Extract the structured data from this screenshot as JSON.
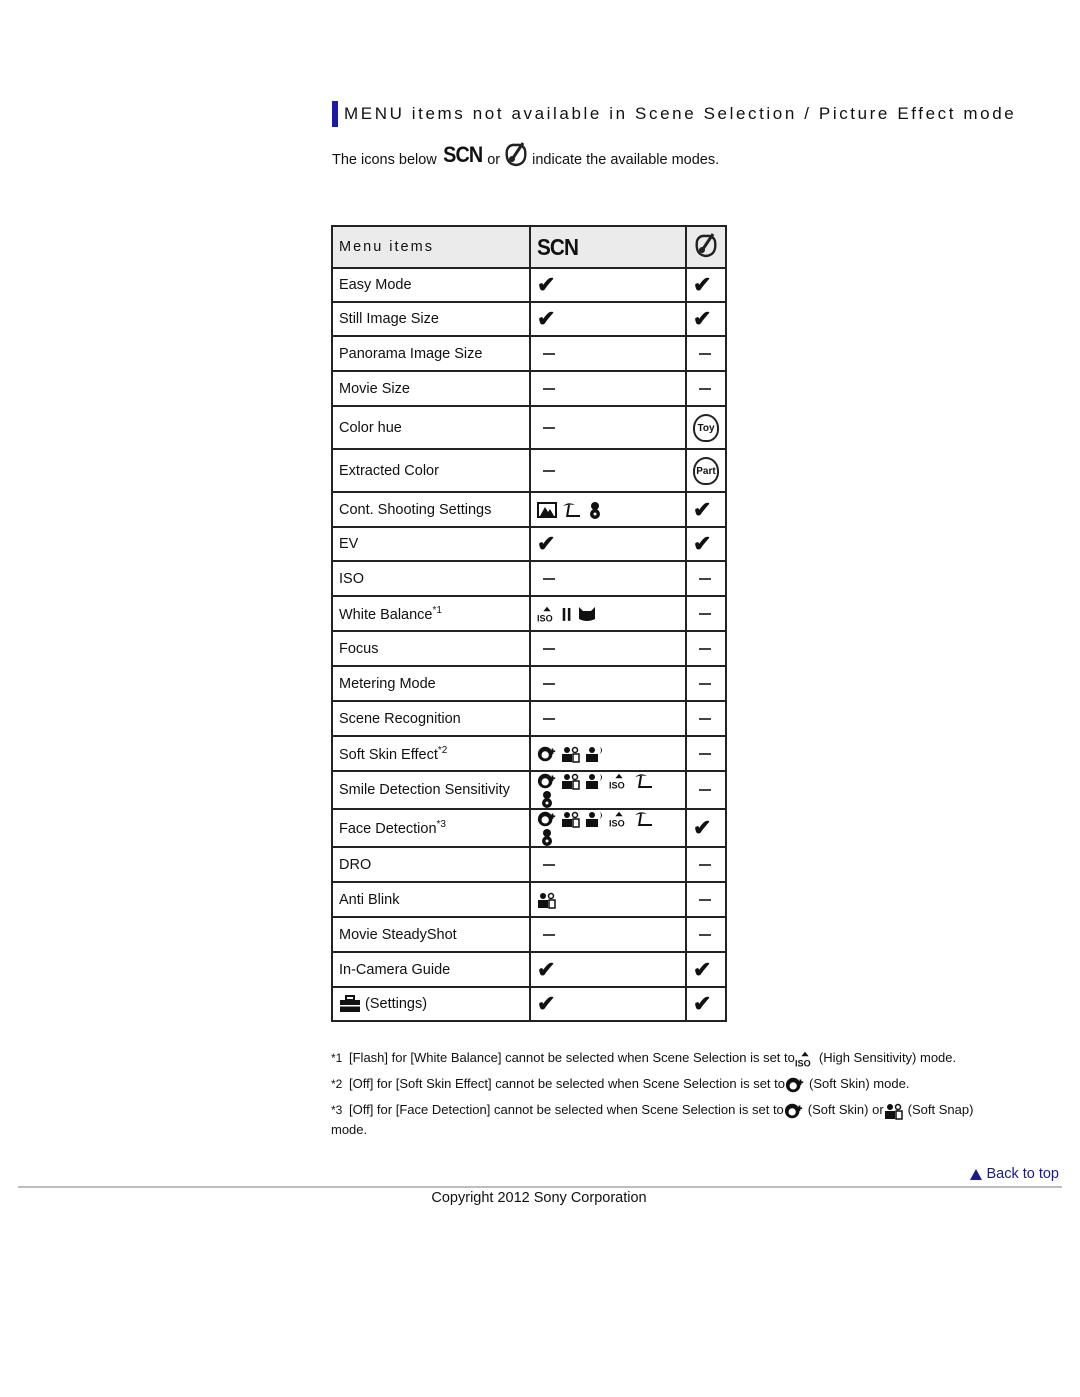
{
  "section": {
    "title": "MENU items not available in Scene Selection / Picture Effect mode",
    "intro_prefix": "The icons below",
    "intro_scn": "SCN",
    "intro_or": "or",
    "intro_suffix": "indicate the available modes.",
    "accent_color": "#1a1aa6"
  },
  "table": {
    "header": {
      "label": "Menu items",
      "col_scn": "SCN",
      "col_pe_icon": "picture-effect-icon"
    },
    "rows": [
      {
        "label": "Easy Mode",
        "scn": "check",
        "pe": "check"
      },
      {
        "label": "Still Image Size",
        "scn": "check",
        "pe": "check"
      },
      {
        "label": "Panorama Image Size",
        "scn": "dash",
        "pe": "dash"
      },
      {
        "label": "Movie Size",
        "scn": "dash",
        "pe": "dash"
      },
      {
        "label": "Color hue",
        "scn": "dash",
        "pe": "Toy"
      },
      {
        "label": "Extracted Color",
        "scn": "dash",
        "pe": "Part"
      },
      {
        "label": "Cont. Shooting Settings",
        "scn": [
          "landscape-icon",
          "beach-icon",
          "snow-icon"
        ],
        "pe": "check"
      },
      {
        "label": "EV",
        "scn": "check",
        "pe": "check"
      },
      {
        "label": "ISO",
        "scn": "dash",
        "pe": "dash"
      },
      {
        "label": "White Balance",
        "sup": "*1",
        "scn": [
          "high-sensitivity-icon",
          "gourmet-icon",
          "pet-icon"
        ],
        "pe": "dash"
      },
      {
        "label": "Focus",
        "scn": "dash",
        "pe": "dash"
      },
      {
        "label": "Metering Mode",
        "scn": "dash",
        "pe": "dash"
      },
      {
        "label": "Scene Recognition",
        "scn": "dash",
        "pe": "dash"
      },
      {
        "label": "Soft Skin Effect",
        "sup": "*2",
        "scn": [
          "soft-skin-icon",
          "soft-snap-icon",
          "night-portrait-icon"
        ],
        "pe": "dash"
      },
      {
        "label": "Smile Detection Sensitivity",
        "scn": [
          "soft-skin-icon",
          "soft-snap-icon",
          "night-portrait-icon",
          "high-sensitivity-icon",
          "beach-icon",
          "snow-icon"
        ],
        "pe": "dash"
      },
      {
        "label": "Face Detection",
        "sup": "*3",
        "scn": [
          "soft-skin-icon",
          "soft-snap-icon",
          "night-portrait-icon",
          "high-sensitivity-icon",
          "beach-icon",
          "snow-icon"
        ],
        "pe": "check"
      },
      {
        "label": "DRO",
        "scn": "dash",
        "pe": "dash"
      },
      {
        "label": "Anti Blink",
        "scn": [
          "soft-snap-icon"
        ],
        "pe": "dash"
      },
      {
        "label": "Movie SteadyShot",
        "scn": "dash",
        "pe": "dash"
      },
      {
        "label": "In-Camera Guide",
        "scn": "check",
        "pe": "check"
      },
      {
        "label": "(Settings)",
        "icon": "toolbox-icon",
        "scn": "check",
        "pe": "check"
      }
    ]
  },
  "footnotes": [
    {
      "mark": "*1",
      "text_before": "[Flash] for [White Balance] cannot be selected when Scene Selection is set to",
      "icon": "high-sensitivity-icon",
      "text_after": "(High Sensitivity) mode."
    },
    {
      "mark": "*2",
      "text_before": "[Off] for [Soft Skin Effect] cannot be selected when Scene Selection is set to",
      "icon": "soft-skin-icon",
      "text_after": "(Soft Skin) mode."
    },
    {
      "mark": "*3",
      "text_before": "[Off] for [Face Detection] cannot be selected when Scene Selection is set to",
      "icon": "soft-skin-icon",
      "text_middle": "(Soft Skin) or",
      "icon2": "soft-snap-icon",
      "text_after": "(Soft Snap)",
      "continuation": "mode."
    }
  ],
  "footer": {
    "back_to_top": "Back to top",
    "link_color": "#1a1a8c",
    "copyright": "Copyright 2012 Sony Corporation"
  }
}
